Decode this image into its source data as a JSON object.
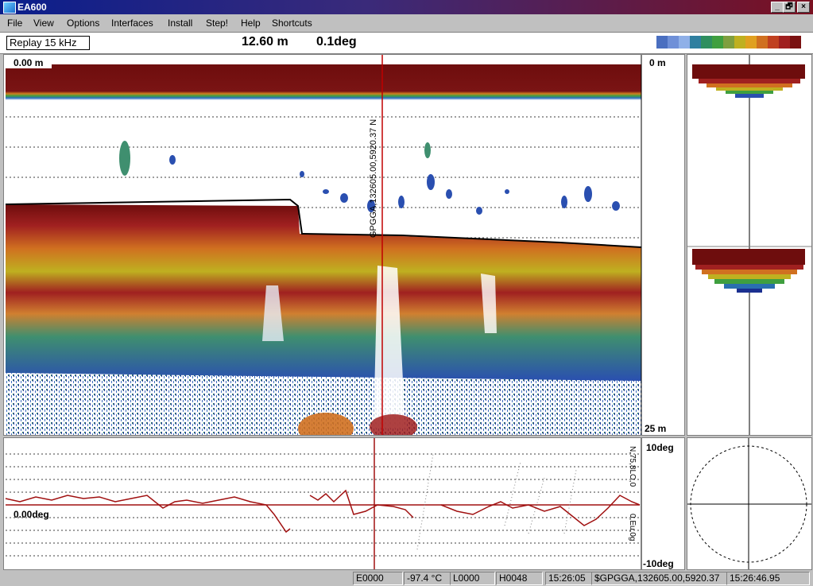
{
  "window": {
    "title": "EA600",
    "buttons": [
      "_",
      "🗗",
      "×"
    ]
  },
  "menu": [
    "File",
    "View",
    "Options",
    "Interfaces",
    "Install",
    "Step!",
    "Help",
    "Shortcuts"
  ],
  "info": {
    "mode": "Replay 15 kHz",
    "depth": "12.60 m",
    "angle": "0.1deg"
  },
  "palette_colors": [
    "#4a6fc0",
    "#6f90d8",
    "#8fb0e8",
    "#2f7f9f",
    "#2f8f5f",
    "#3f9f3f",
    "#7f9f3f",
    "#bfb020",
    "#e0a020",
    "#d07020",
    "#c04020",
    "#a02020",
    "#7a1010"
  ],
  "echogram": {
    "top_label": "0.00 m",
    "range_top": "0 m",
    "range_bottom": "25 m",
    "annotation": "GPGGA,132605.00,5920.37 N"
  },
  "heave": {
    "zero_label": "0.00deg",
    "top_label": "10deg",
    "bottom_label": "-10deg",
    "vertical_note_top": "N,75,8LO,0",
    "vertical_note_bottom": "0,Eu,0g"
  },
  "status": {
    "e": "E0000",
    "temp": "-97.4 °C",
    "l": "L0000",
    "h": "H0048",
    "time": "15:26:05",
    "nmea": "$GPGGA,132605.00,5920.37",
    "clock": "15:26:46.95"
  },
  "colors": {
    "echo_dark": "#6e0d0d",
    "trace": "#a01010",
    "marker": "#c00000"
  }
}
